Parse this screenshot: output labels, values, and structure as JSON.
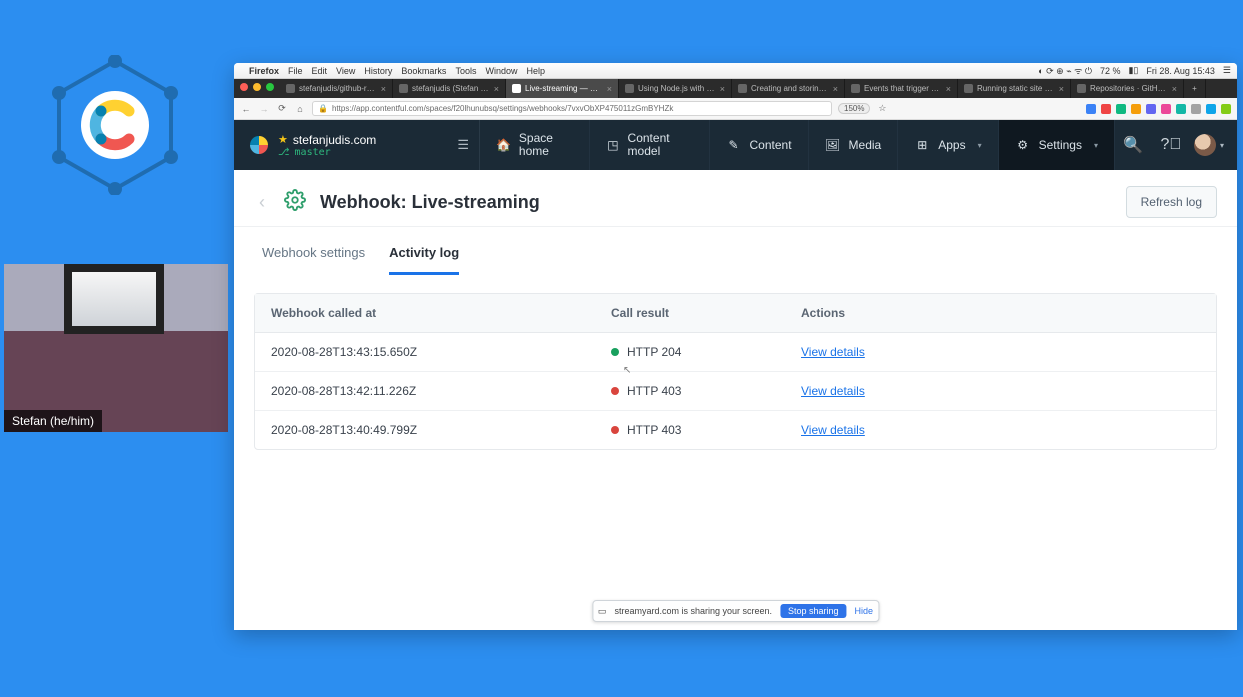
{
  "webcam": {
    "name": "Stefan (he/him)"
  },
  "mac_menu": {
    "app": "Firefox",
    "items": [
      "File",
      "Edit",
      "View",
      "History",
      "Bookmarks",
      "Tools",
      "Window",
      "Help"
    ],
    "battery": "72 %",
    "clock": "Fri 28. Aug  15:43"
  },
  "browser": {
    "tabs": [
      {
        "label": "stefanjudis/github-readme-w…",
        "active": false
      },
      {
        "label": "stefanjudis (Stefan Judis) · …",
        "active": false
      },
      {
        "label": "Live-streaming — Webhooks",
        "active": true
      },
      {
        "label": "Using Node.js with GitHub A…",
        "active": false
      },
      {
        "label": "Creating and storing encryp…",
        "active": false
      },
      {
        "label": "Events that trigger workflow…",
        "active": false
      },
      {
        "label": "Running static site builds wi…",
        "active": false
      },
      {
        "label": "Repositories · GitHub Docs",
        "active": false
      }
    ],
    "url": "https://app.contentful.com/spaces/f20lhunubsq/settings/webhooks/7vxvObXP475011zGmBYHZk",
    "zoom": "150%"
  },
  "cf": {
    "space": "stefanjudis.com",
    "env": "master",
    "nav": {
      "space_home": "Space home",
      "content_model": "Content model",
      "content": "Content",
      "media": "Media",
      "apps": "Apps",
      "settings": "Settings"
    }
  },
  "page": {
    "title": "Webhook: Live-streaming",
    "refresh": "Refresh log",
    "tabs": {
      "settings": "Webhook settings",
      "activity": "Activity log"
    }
  },
  "table": {
    "headers": {
      "called_at": "Webhook called at",
      "result": "Call result",
      "actions": "Actions"
    },
    "view_details": "View details",
    "rows": [
      {
        "ts": "2020-08-28T13:43:15.650Z",
        "status": "HTTP 204",
        "ok": true
      },
      {
        "ts": "2020-08-28T13:42:11.226Z",
        "status": "HTTP 403",
        "ok": false
      },
      {
        "ts": "2020-08-28T13:40:49.799Z",
        "status": "HTTP 403",
        "ok": false
      }
    ]
  },
  "share_bar": {
    "msg": "streamyard.com is sharing your screen.",
    "stop": "Stop sharing",
    "hide": "Hide"
  },
  "ext_colors": [
    "#3b82f6",
    "#ef4444",
    "#10b981",
    "#f59e0b",
    "#6366f1",
    "#ec4899",
    "#14b8a6",
    "#a3a3a3",
    "#0ea5e9",
    "#84cc16"
  ]
}
